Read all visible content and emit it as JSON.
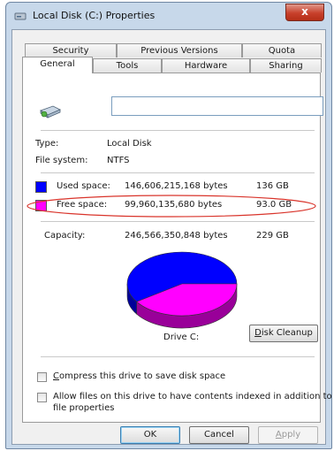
{
  "window": {
    "title": "Local Disk (C:) Properties",
    "close_glyph": "x"
  },
  "tabs": {
    "row1": [
      "Security",
      "Previous Versions",
      "Quota"
    ],
    "row2": [
      "General",
      "Tools",
      "Hardware",
      "Sharing"
    ],
    "active": "General"
  },
  "general": {
    "name_value": "",
    "type_label": "Type:",
    "type_value": "Local Disk",
    "fs_label": "File system:",
    "fs_value": "NTFS",
    "used": {
      "label": "Used space:",
      "bytes": "146,606,215,168 bytes",
      "size": "136 GB",
      "color": "#0000ff"
    },
    "free": {
      "label": "Free space:",
      "bytes": "99,960,135,680 bytes",
      "size": "93.0 GB",
      "color": "#ff00ff"
    },
    "capacity": {
      "label": "Capacity:",
      "bytes": "246,566,350,848 bytes",
      "size": "229 GB"
    },
    "drive_label": "Drive C:",
    "cleanup_mnemonic": "D",
    "cleanup_rest": "isk Cleanup",
    "used_fraction": 0.5946,
    "compress_mnemonic": "C",
    "compress_rest": "ompress this drive to save disk space",
    "compress_checked": false,
    "index_line1": "Allow files on this drive to have contents indexed in addition to",
    "index_line2": "file properties",
    "index_checked": false,
    "highlight_color": "#d9342b"
  },
  "buttons": {
    "ok": "OK",
    "cancel": "Cancel",
    "apply_mnemonic": "A",
    "apply_rest": "pply"
  }
}
